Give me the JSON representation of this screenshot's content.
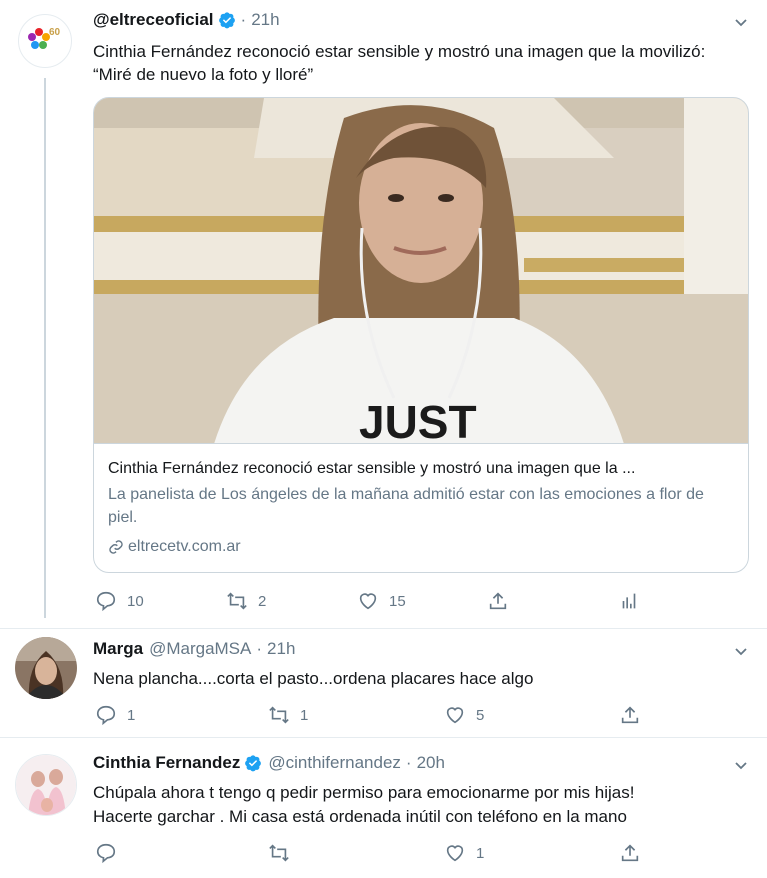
{
  "tweet_main": {
    "name": "@eltreceoficial",
    "time": "21h",
    "text": "Cinthia Fernández reconoció estar sensible y mostró una imagen que la movilizó: “Miré de nuevo la foto y lloré”",
    "avatar_text": "60",
    "card": {
      "title": "Cinthia Fernández reconoció estar sensible y mostró una imagen que la ...",
      "description": "La panelista de Los ángeles de la mañana admitió estar con las emociones a flor de piel.",
      "link": "eltrecetv.com.ar",
      "shirt_text": "JUST"
    },
    "actions": {
      "replies": "10",
      "retweets": "2",
      "likes": "15"
    }
  },
  "reply_1": {
    "name": "Marga",
    "handle": "@MargaMSA",
    "time": "21h",
    "text": "Nena plancha....corta el pasto...ordena placares hace algo",
    "actions": {
      "replies": "1",
      "retweets": "1",
      "likes": "5"
    }
  },
  "reply_2": {
    "name": "Cinthia Fernandez",
    "handle": "@cinthifernandez",
    "time": "20h",
    "text_line1": "Chúpala ahora t tengo q pedir permiso para emocionarme por mis hijas!",
    "text_line2": "Hacerte garchar .  Mi casa está ordenada inútil con teléfono en la mano",
    "actions": {
      "likes": "1"
    }
  },
  "colors": {
    "verified": "#1da1f2",
    "muted": "#657786",
    "border": "#ccd6dd"
  }
}
